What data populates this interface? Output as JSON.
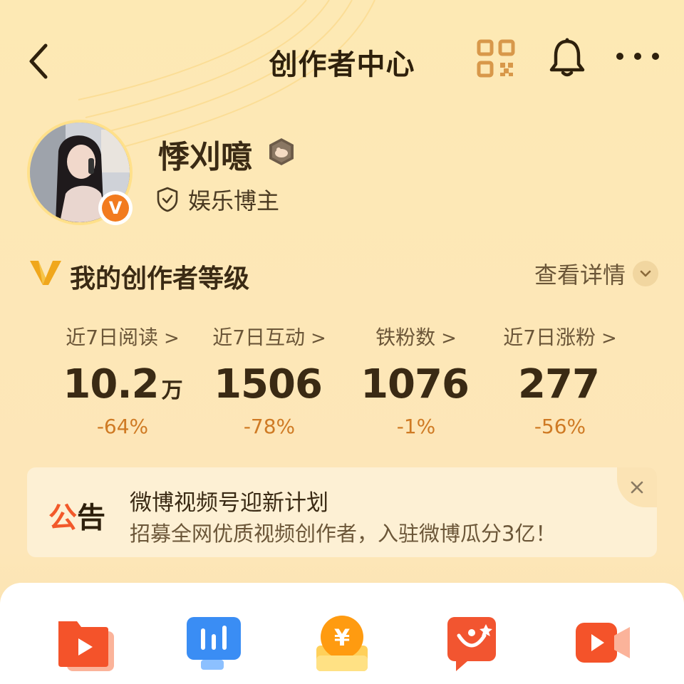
{
  "header": {
    "title": "创作者中心",
    "back_icon": "chevron-left-icon",
    "qr_icon": "qr-code-icon",
    "bell_icon": "bell-icon",
    "more_icon": "more-horizontal-icon"
  },
  "profile": {
    "name": "悸刈噫",
    "verified_badge": "V",
    "category": "娱乐博主"
  },
  "level": {
    "title": "我的创作者等级",
    "detail_label": "查看详情"
  },
  "stats": [
    {
      "label": "近7日阅读",
      "value": "10.2",
      "unit": "万",
      "change": "-64%"
    },
    {
      "label": "近7日互动",
      "value": "1506",
      "unit": "",
      "change": "-78%"
    },
    {
      "label": "铁粉数",
      "value": "1076",
      "unit": "",
      "change": "-1%"
    },
    {
      "label": "近7日涨粉",
      "value": "277",
      "unit": "",
      "change": "-56%"
    }
  ],
  "notice": {
    "tag_part1": "公",
    "tag_part2": "告",
    "title": "微博视频号迎新计划",
    "subtitle": "招募全网优质视频创作者，入驻微博瓜分3亿！"
  },
  "tools": [
    {
      "icon": "video-folder-icon"
    },
    {
      "icon": "data-analytics-icon"
    },
    {
      "icon": "income-yuan-icon"
    },
    {
      "icon": "creator-incentive-icon"
    },
    {
      "icon": "video-camera-icon"
    }
  ],
  "colors": {
    "background": "#fde9b4",
    "accent_orange": "#f27b1f",
    "change_text": "#cf7a24",
    "notice_red": "#f2592a"
  }
}
